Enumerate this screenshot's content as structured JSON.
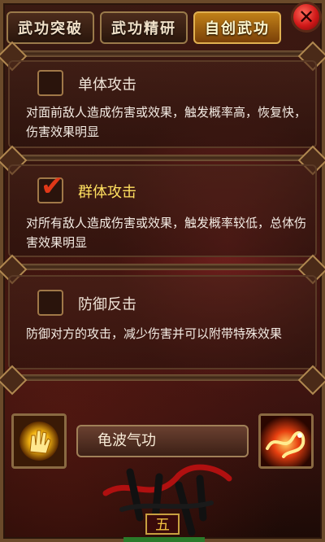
{
  "tabs": [
    {
      "label": "武功突破",
      "active": false
    },
    {
      "label": "武功精研",
      "active": false
    },
    {
      "label": "自创武功",
      "active": true
    }
  ],
  "close": {
    "icon": "close-icon",
    "glyph": "✕"
  },
  "options": [
    {
      "title": "单体攻击",
      "checked": false,
      "desc": "对面前敌人造成伤害或效果，触发概率高，恢复快，伤害效果明显"
    },
    {
      "title": "群体攻击",
      "checked": true,
      "check_glyph": "✔",
      "desc": "对所有敌人造成伤害或效果，触发概率较低，总体伤害效果明显"
    },
    {
      "title": "防御反击",
      "checked": false,
      "desc": "防御对方的攻击，减少伤害并可以附带特殊效果"
    }
  ],
  "skill": {
    "name": "龟波气功",
    "left_icon": "golden-hand-icon",
    "right_icon": "fire-dragon-icon"
  },
  "logo": {
    "icon": "game-logo",
    "subtitle": "五"
  },
  "colors": {
    "accent": "#e0b050",
    "checkmark": "#e03818",
    "selected_title": "#ffe060"
  }
}
